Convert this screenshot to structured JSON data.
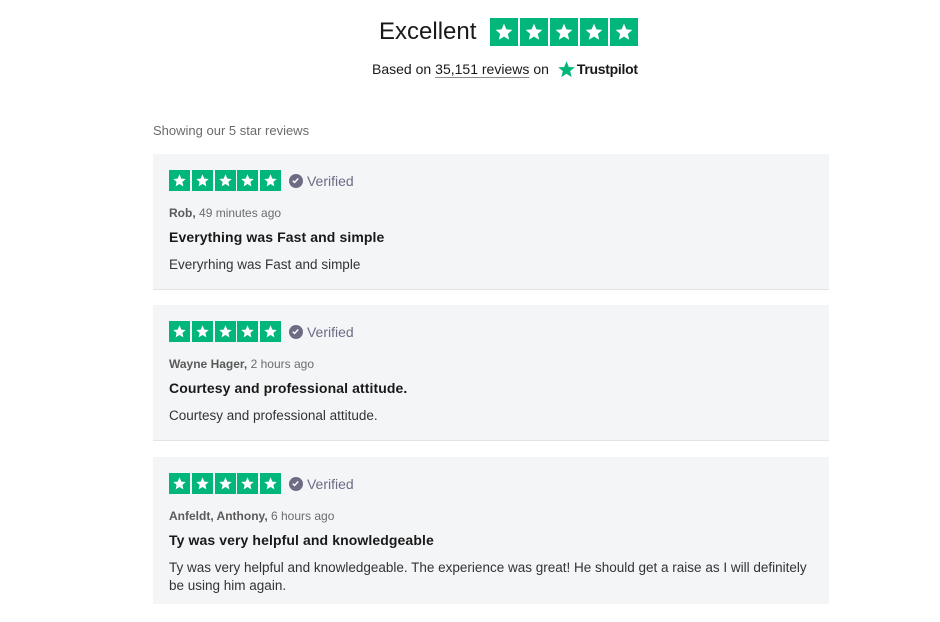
{
  "header": {
    "rating_word": "Excellent",
    "stars": 5,
    "based_on_prefix": "Based on",
    "review_count_link": "35,151 reviews",
    "based_on_suffix": "on",
    "brand": "Trustpilot",
    "brand_color": "#00b67a"
  },
  "filter": {
    "showing_text": "Showing our 5 star reviews"
  },
  "reviews": [
    {
      "stars": 5,
      "verified_label": "Verified",
      "author": "Rob,",
      "time": "49 minutes ago",
      "title": "Everything was Fast and simple",
      "body": "Everyrhing was Fast and simple"
    },
    {
      "stars": 5,
      "verified_label": "Verified",
      "author": "Wayne Hager,",
      "time": "2 hours ago",
      "title": "Courtesy and professional attitude.",
      "body": "Courtesy and professional attitude."
    },
    {
      "stars": 5,
      "verified_label": "Verified",
      "author": "Anfeldt, Anthony,",
      "time": "6 hours ago",
      "title": "Ty was very helpful and knowledgeable",
      "body": "Ty was very helpful and knowledgeable. The experience was great! He should get a raise as I will definitely be using him again."
    }
  ],
  "icons": {
    "star": "star-icon",
    "verified": "check-circle-icon",
    "brand": "trustpilot-star-icon"
  }
}
